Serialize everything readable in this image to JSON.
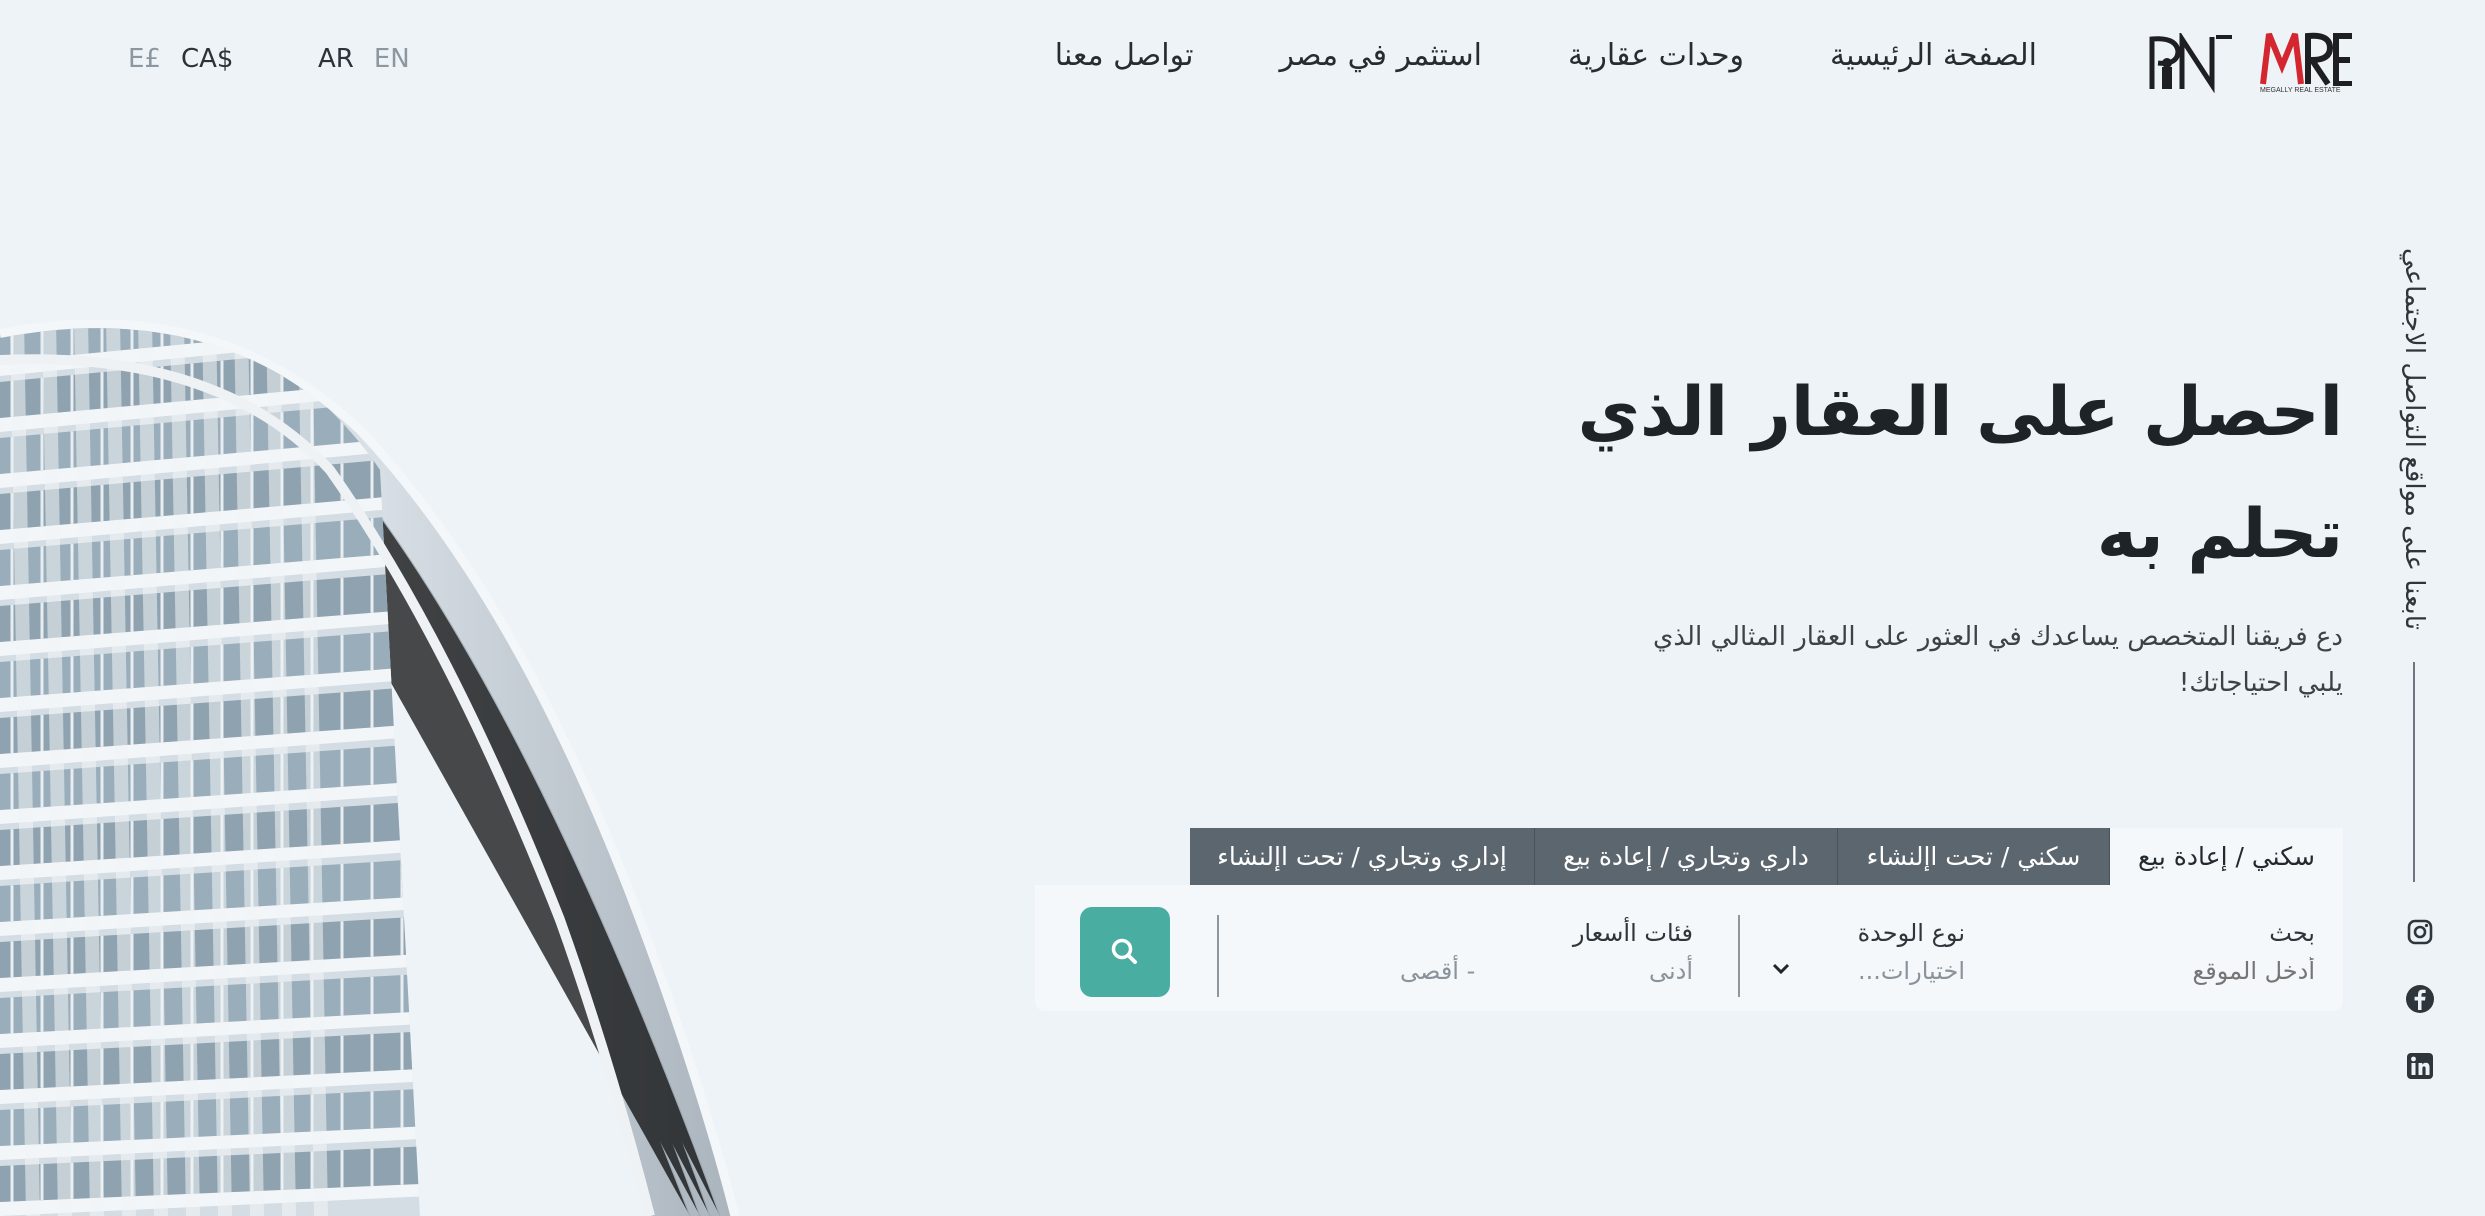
{
  "header": {
    "logo_mre_caption": "MEGALLY REAL ESTATE",
    "nav": [
      {
        "label": "الصفحة الرئيسية"
      },
      {
        "label": "وحدات عقارية"
      },
      {
        "label": "استثمر في مصر"
      },
      {
        "label": "تواصل معنا"
      }
    ],
    "language": {
      "en": "EN",
      "ar": "AR",
      "active": "AR"
    },
    "currency": {
      "cad": "CA$",
      "egp": "E£",
      "active": "CA$"
    }
  },
  "hero": {
    "title_line1": "احصل على العقار الذي",
    "title_line2": "تحلم به",
    "subtitle_line1": "دع فريقنا المتخصص يساعدك في العثور على العقار المثالي الذي",
    "subtitle_line2": "يلبي احتياجاتك!"
  },
  "social": {
    "label": "تابعنا على مواقع التواصل الاجتماعي",
    "icons": [
      "instagram-icon",
      "facebook-icon",
      "linkedin-icon"
    ]
  },
  "tabs": [
    {
      "label": "سكني / إعادة بيع",
      "active": true
    },
    {
      "label": "سكني / تحت اإلنشاء",
      "active": false
    },
    {
      "label": "داري وتجاري / إعادة بيع",
      "active": false
    },
    {
      "label": "إداري وتجاري / تحت اإلنشاء",
      "active": false
    }
  ],
  "search": {
    "location_label": "بحث",
    "location_placeholder": "أدخل الموقع",
    "unit_type_label": "نوع الوحدة",
    "unit_type_value": "اختيارات...",
    "price_label": "فئات اأسعار",
    "price_min_placeholder": "أدنى",
    "price_max_placeholder": "- أقصى"
  },
  "colors": {
    "background": "#eef3f7",
    "tab_inactive": "#5c666e",
    "search_button": "#4aada2",
    "logo_red": "#d3262e"
  }
}
